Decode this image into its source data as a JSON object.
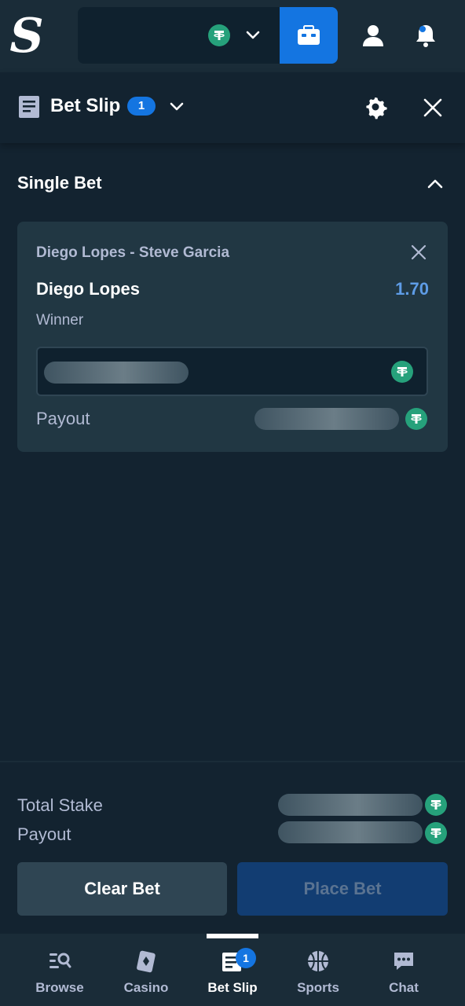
{
  "header": {
    "logo_icon": "stake-s-logo-icon",
    "currency_icon": "tether-coin-icon",
    "chevron_icon": "chevron-down-icon",
    "wallet_icon": "wallet-icon",
    "user_icon": "user-icon",
    "notifications_icon": "bell-icon",
    "accent_color": "#1475e1"
  },
  "bet_slip": {
    "title": "Bet Slip",
    "count": "1",
    "icon": "bet-slip-icon",
    "settings_icon": "gear-icon",
    "close_icon": "close-icon"
  },
  "section": {
    "title": "Single Bet",
    "toggle_icon": "chevron-up-icon"
  },
  "bet": {
    "event": "Diego Lopes - Steve Garcia",
    "selection": "Diego Lopes",
    "odds": "1.70",
    "market": "Winner",
    "payout_label": "Payout",
    "remove_icon": "close-icon",
    "odds_color": "#5e9ce6"
  },
  "summary": {
    "total_stake_label": "Total Stake",
    "payout_label": "Payout"
  },
  "actions": {
    "clear_label": "Clear Bet",
    "place_label": "Place Bet"
  },
  "nav": {
    "items": [
      {
        "label": "Browse",
        "icon": "browse-icon"
      },
      {
        "label": "Casino",
        "icon": "cards-icon"
      },
      {
        "label": "Bet Slip",
        "icon": "bet-slip-icon",
        "badge": "1"
      },
      {
        "label": "Sports",
        "icon": "basketball-icon"
      },
      {
        "label": "Chat",
        "icon": "chat-icon"
      }
    ]
  }
}
